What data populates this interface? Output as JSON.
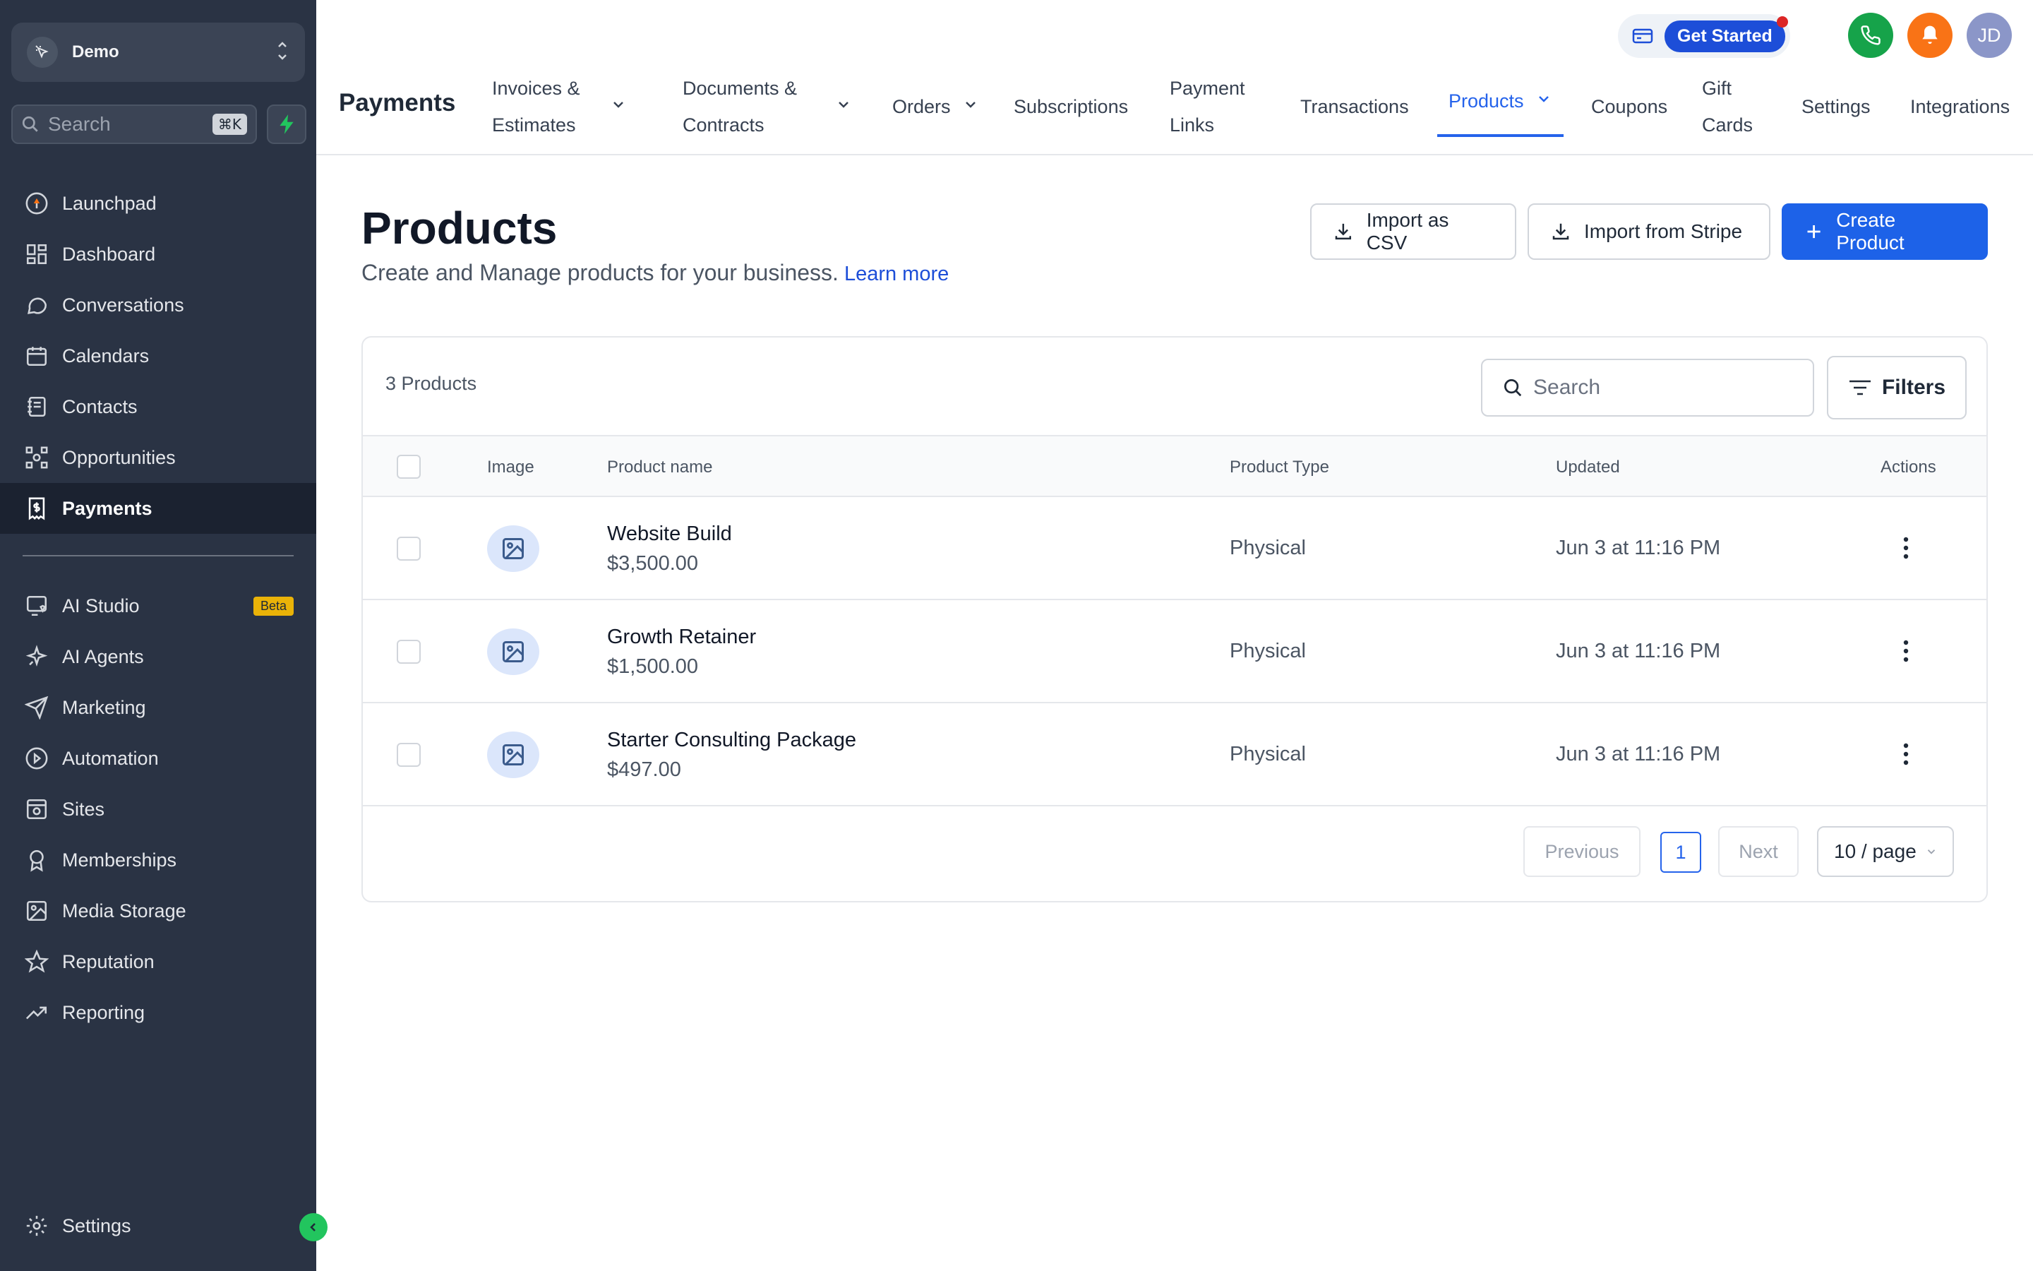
{
  "sidebar": {
    "account_name": "Demo",
    "search_placeholder": "Search",
    "search_shortcut": "⌘K",
    "items": [
      {
        "label": "Launchpad",
        "icon": "launchpad-icon"
      },
      {
        "label": "Dashboard",
        "icon": "dashboard-icon"
      },
      {
        "label": "Conversations",
        "icon": "chat-icon"
      },
      {
        "label": "Calendars",
        "icon": "calendar-icon"
      },
      {
        "label": "Contacts",
        "icon": "contacts-icon"
      },
      {
        "label": "Opportunities",
        "icon": "opportunities-icon"
      },
      {
        "label": "Payments",
        "icon": "payments-icon",
        "active": true
      }
    ],
    "items2": [
      {
        "label": "AI Studio",
        "icon": "ai-studio-icon",
        "badge": "Beta"
      },
      {
        "label": "AI Agents",
        "icon": "sparkle-icon"
      },
      {
        "label": "Marketing",
        "icon": "send-icon"
      },
      {
        "label": "Automation",
        "icon": "automation-icon"
      },
      {
        "label": "Sites",
        "icon": "sites-icon"
      },
      {
        "label": "Memberships",
        "icon": "award-icon"
      },
      {
        "label": "Media Storage",
        "icon": "image-icon"
      },
      {
        "label": "Reputation",
        "icon": "star-icon"
      },
      {
        "label": "Reporting",
        "icon": "trend-icon"
      }
    ],
    "settings_label": "Settings"
  },
  "topbar": {
    "brand": "Payments",
    "nav": [
      {
        "label": "Invoices & Estimates",
        "line1": "Invoices &",
        "line2": "Estimates",
        "dropdown": true
      },
      {
        "label": "Documents & Contracts",
        "line1": "Documents &",
        "line2": "Contracts",
        "dropdown": true
      },
      {
        "label": "Orders",
        "dropdown": true
      },
      {
        "label": "Subscriptions"
      },
      {
        "label": "Payment Links",
        "line1": "Payment",
        "line2": "Links"
      },
      {
        "label": "Transactions"
      },
      {
        "label": "Products",
        "dropdown": true,
        "active": true
      },
      {
        "label": "Coupons"
      },
      {
        "label": "Gift Cards",
        "line1": "Gift",
        "line2": "Cards"
      },
      {
        "label": "Settings"
      },
      {
        "label": "Integrations"
      }
    ],
    "get_started": "Get Started",
    "avatar_initials": "JD"
  },
  "page": {
    "title": "Products",
    "subtitle": "Create and Manage products for your business.",
    "learn_more": "Learn more",
    "import_csv": "Import as CSV",
    "import_stripe": "Import from Stripe",
    "create": "Create Product"
  },
  "table": {
    "count": "3 Products",
    "search_placeholder": "Search",
    "filters": "Filters",
    "columns": {
      "image": "Image",
      "name": "Product name",
      "type": "Product Type",
      "updated": "Updated",
      "actions": "Actions"
    },
    "rows": [
      {
        "name": "Website Build",
        "price": "$3,500.00",
        "type": "Physical",
        "updated": "Jun 3 at 11:16 PM"
      },
      {
        "name": "Growth Retainer",
        "price": "$1,500.00",
        "type": "Physical",
        "updated": "Jun 3 at 11:16 PM"
      },
      {
        "name": "Starter Consulting Package",
        "price": "$497.00",
        "type": "Physical",
        "updated": "Jun 3 at 11:16 PM"
      }
    ]
  },
  "pagination": {
    "previous": "Previous",
    "current": "1",
    "next": "Next",
    "per_page": "10 / page"
  },
  "colors": {
    "sidebar": "#2a3344",
    "accent": "#1d62e8",
    "phone": "#16a34a",
    "bell": "#f97316",
    "avatar": "#8b96c8"
  }
}
